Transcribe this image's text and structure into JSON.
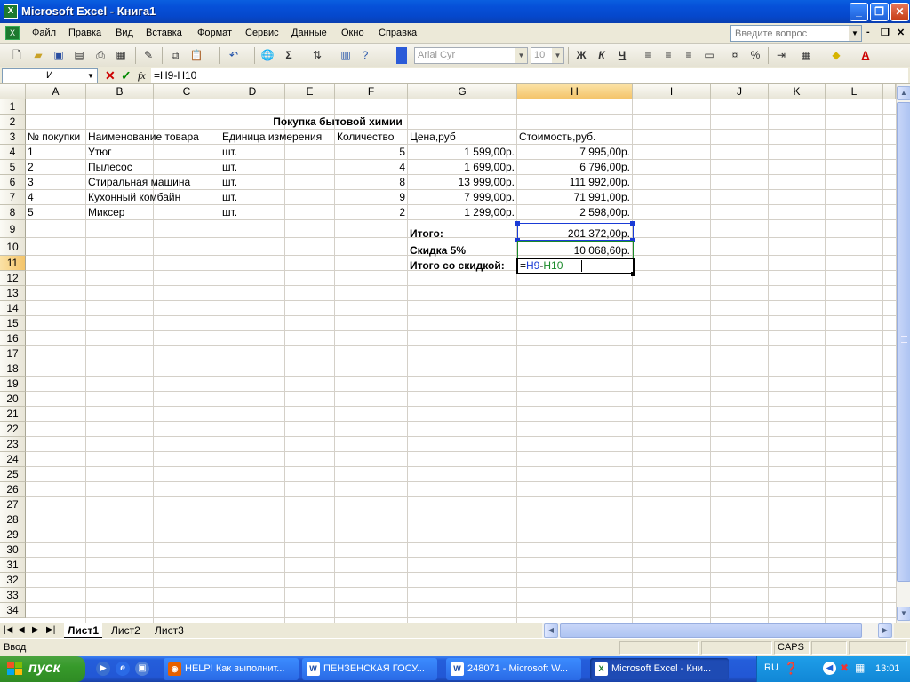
{
  "window": {
    "title": "Microsoft Excel - Книга1",
    "app_icon": "excel-icon",
    "controls": [
      "_",
      "❐",
      "✕"
    ]
  },
  "menu": {
    "items": [
      "Файл",
      "Правка",
      "Вид",
      "Вставка",
      "Формат",
      "Сервис",
      "Данные",
      "Окно",
      "Справка"
    ],
    "help_placeholder": "Введите вопрос",
    "doc_controls": [
      "-",
      "❐",
      "✕"
    ]
  },
  "toolbar": {
    "font_name": "Arial Cyr",
    "font_size": "10",
    "bold": "Ж",
    "italic": "К",
    "underline": "Ч",
    "sum": "Σ",
    "percent": "%",
    "font_color": "A"
  },
  "formula_bar": {
    "name_box": "И",
    "cancel": "✕",
    "enter": "✓",
    "fx": "fx",
    "formula": "=H9-H10"
  },
  "columns": [
    "A",
    "B",
    "C",
    "D",
    "E",
    "F",
    "G",
    "H",
    "I",
    "J",
    "K",
    "L"
  ],
  "selected_column": "H",
  "selected_row": 11,
  "rows": [
    "1",
    "2",
    "3",
    "4",
    "5",
    "6",
    "7",
    "8",
    "9",
    "10",
    "11",
    "12",
    "13",
    "14",
    "15",
    "16",
    "17",
    "18",
    "19",
    "20",
    "21",
    "22",
    "23",
    "24",
    "25",
    "26",
    "27",
    "28",
    "29",
    "30",
    "31",
    "32",
    "33",
    "34"
  ],
  "sheet": {
    "title": "Покупка бытовой химии",
    "headers": {
      "A": "№ покупки",
      "B": "Наименование товара",
      "D": "Единица измерения",
      "F": "Количество",
      "G": "Цена,руб",
      "H": "Стоимость,руб."
    },
    "items": [
      {
        "no": "1",
        "name": "Утюг",
        "unit": "шт.",
        "qty": "5",
        "price": "1 599,00р.",
        "cost": "7 995,00р."
      },
      {
        "no": "2",
        "name": "Пылесос",
        "unit": "шт.",
        "qty": "4",
        "price": "1 699,00р.",
        "cost": "6 796,00р."
      },
      {
        "no": "3",
        "name": "Стиральная машина",
        "unit": "шт.",
        "qty": "8",
        "price": "13 999,00р.",
        "cost": "111 992,00р."
      },
      {
        "no": "4",
        "name": "Кухонный комбайн",
        "unit": "шт.",
        "qty": "9",
        "price": "7 999,00р.",
        "cost": "71 991,00р."
      },
      {
        "no": "5",
        "name": "Миксер",
        "unit": "шт.",
        "qty": "2",
        "price": "1 299,00р.",
        "cost": "2 598,00р."
      }
    ],
    "total_label": "Итого:",
    "total_value": "201 372,00р.",
    "discount_label": "Скидка 5%",
    "discount_value": "10 068,60р.",
    "final_label": "Итого со скидкой:",
    "final_formula": "=H9-H10"
  },
  "tabs": {
    "nav": [
      "|◀",
      "◀",
      "▶",
      "▶|"
    ],
    "sheets": [
      "Лист1",
      "Лист2",
      "Лист3"
    ],
    "active": "Лист1"
  },
  "status": {
    "mode": "Ввод",
    "caps": "CAPS"
  },
  "taskbar": {
    "start": "пуск",
    "tasks": [
      {
        "label": "HELP! Как выполнит...",
        "icon": "firefox-icon"
      },
      {
        "label": "ПЕНЗЕНСКАЯ ГОСУ...",
        "icon": "word-icon"
      },
      {
        "label": "248071 - Microsoft W...",
        "icon": "word-icon"
      },
      {
        "label": "Microsoft Excel - Кни...",
        "icon": "excel-icon"
      }
    ],
    "lang": "RU",
    "clock": "13:01"
  }
}
